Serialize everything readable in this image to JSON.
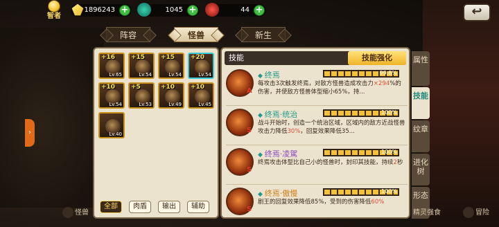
{
  "topbar": {
    "rank_label": "智者",
    "gold": "1896243",
    "teal_currency": "1045",
    "red_currency": "44",
    "plus": "+"
  },
  "tabs": [
    {
      "label": "阵容",
      "active": false
    },
    {
      "label": "怪兽",
      "active": true
    },
    {
      "label": "新生",
      "active": false
    }
  ],
  "monsters": [
    {
      "star": "+16",
      "level": "Lv.65"
    },
    {
      "star": "+15",
      "level": "Lv.54"
    },
    {
      "star": "+15",
      "level": "Lv.54"
    },
    {
      "star": "+20",
      "level": "Lv.54"
    },
    {
      "star": "+10",
      "level": "Lv.54"
    },
    {
      "star": "+5",
      "level": "Lv.53"
    },
    {
      "star": "+10",
      "level": "Lv.49"
    },
    {
      "star": "+10",
      "level": "Lv.45"
    },
    {
      "star": "",
      "level": "Lv.40"
    }
  ],
  "filters": [
    "全部",
    "肉盾",
    "输出",
    "辅助"
  ],
  "skills_panel": {
    "title": "技能",
    "enhance": "技能强化",
    "skills": [
      {
        "name": "终焉",
        "grade": "A",
        "progress": 99.8,
        "pct": "99.8%",
        "desc_a": "每攻击3次触发终焉，对敌方怪兽造成攻击力",
        "desc_hl": "×294",
        "desc_b": "%的伤害，并使敌方怪兽体型缩小65%，持..."
      },
      {
        "name": "终焉·统治",
        "grade": "S",
        "progress": 100,
        "pct": "100%",
        "desc_a": "战斗开始时，创造一个统治区域，区域内的敌方近战怪兽攻击力降低",
        "desc_hl": "30%",
        "desc_b": "，回复效果降低35..."
      },
      {
        "name": "终焉·凌駕",
        "grade": "S",
        "progress": 100,
        "pct": "100%",
        "desc_a": "终焉攻击体型比自己小的怪兽时，封印其技能，持续",
        "desc_hl": "2",
        "desc_b": "秒"
      },
      {
        "name": "终焉·傲慢",
        "grade": "S",
        "progress": 100,
        "pct": "100%",
        "desc_a": "剧王的回复效果降低85%，受到的伤害降低",
        "desc_hl": "60%",
        "desc_b": ""
      }
    ]
  },
  "side_tabs": [
    {
      "label": "属性",
      "active": false
    },
    {
      "label": "技能",
      "active": true
    },
    {
      "label": "纹章",
      "active": false
    },
    {
      "label": "进化树",
      "active": false
    },
    {
      "label": "形态",
      "active": false
    }
  ],
  "bottom_nav": {
    "monster": "怪兽",
    "strengthen": "精灵强食",
    "adventure": "冒险"
  }
}
